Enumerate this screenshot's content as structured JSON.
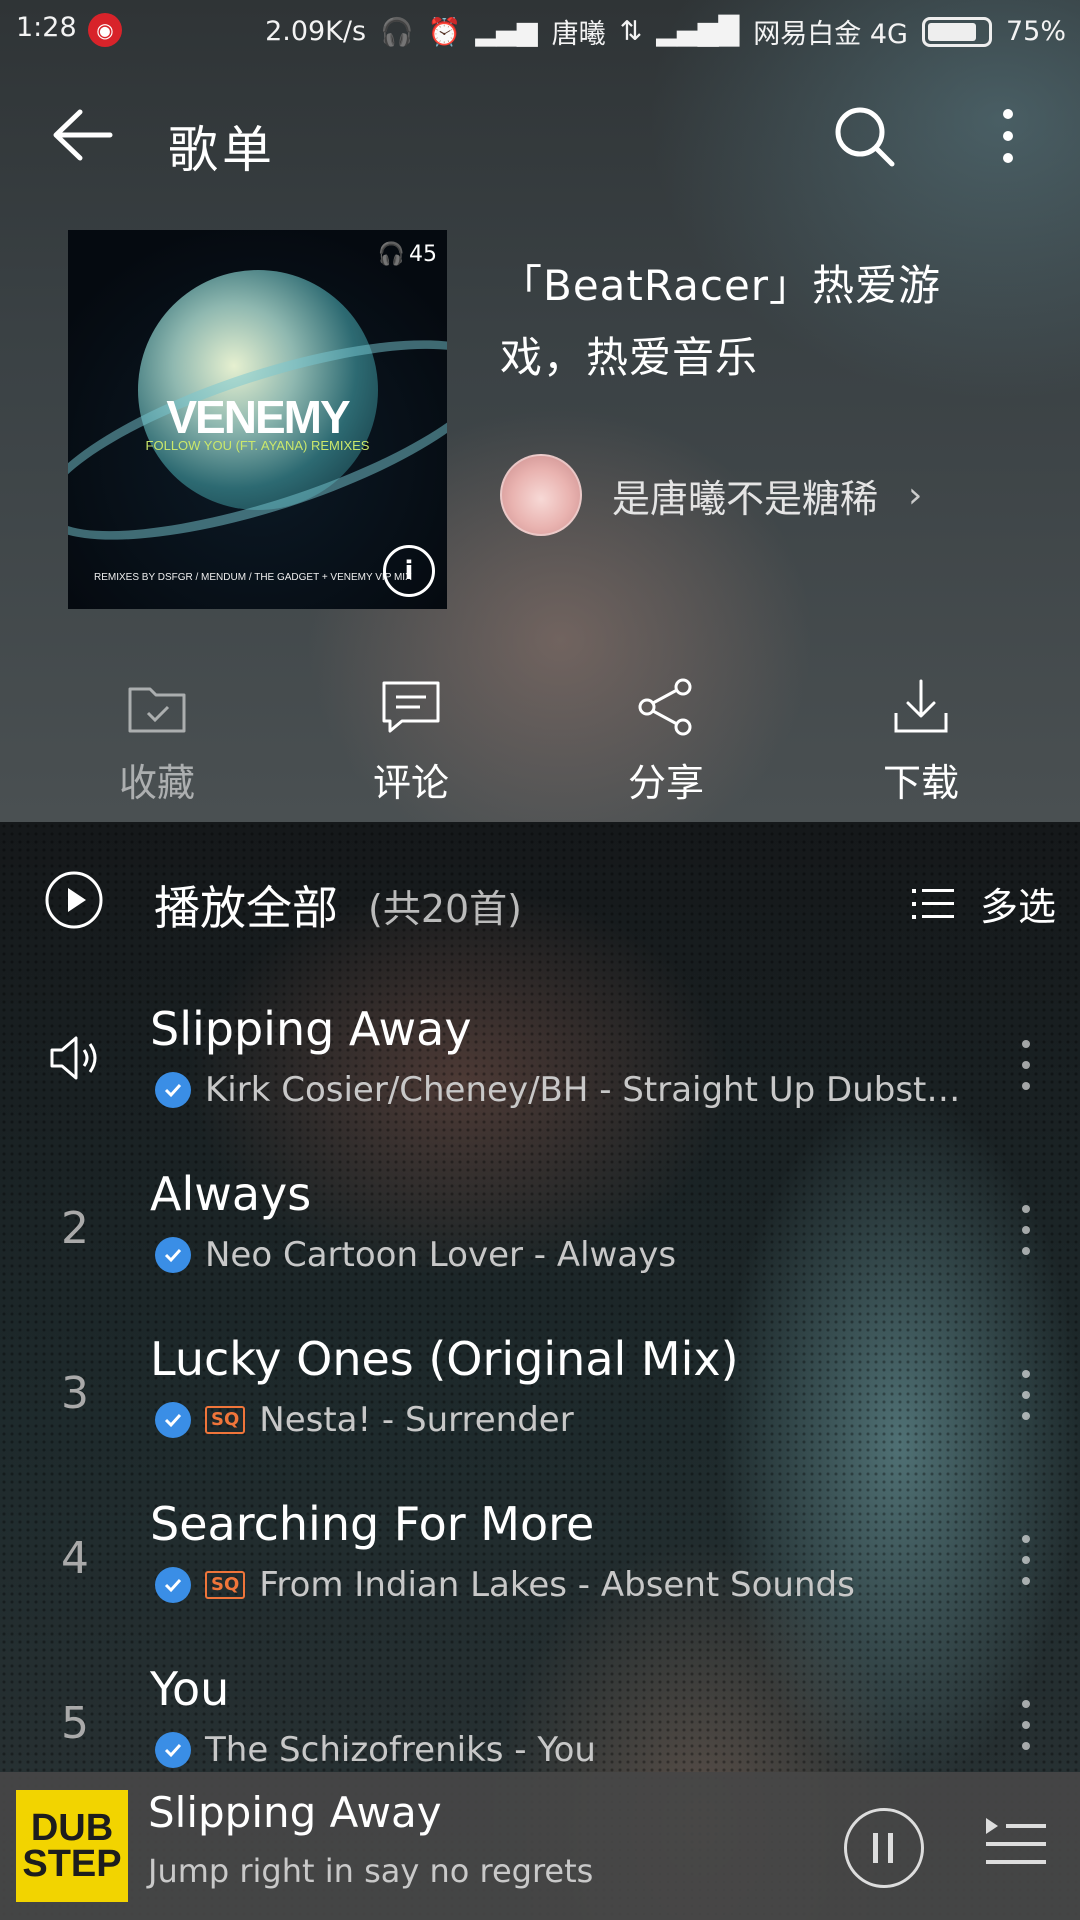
{
  "statusbar": {
    "time": "1:28",
    "speed": "2.09K/s",
    "carrier1": "唐曦",
    "carrier2": "网易白金 4G",
    "battery": "75%"
  },
  "header": {
    "title": "歌单"
  },
  "playlist": {
    "title": "「BeatRacer」热爱游戏，热爱音乐",
    "creator": "是唐曦不是糖稀",
    "cover": {
      "brand": "VENEMY",
      "subtitle": "FOLLOW YOU (FT. AYANA) REMIXES",
      "credits": "REMIXES BY DSFGR / MENDUM / THE GADGET + VENEMY VIP MIX",
      "plays": "45"
    }
  },
  "actions": [
    {
      "label": "收藏"
    },
    {
      "label": "评论"
    },
    {
      "label": "分享"
    },
    {
      "label": "下载"
    }
  ],
  "playall": {
    "label": "播放全部",
    "count": "(共20首)",
    "multi": "多选"
  },
  "songs": [
    {
      "num": "",
      "title": "Slipping Away",
      "sq": "",
      "sub": "Kirk Cosier/Cheney/BH - Straight Up Dubst…"
    },
    {
      "num": "2",
      "title": "Always",
      "sq": "",
      "sub": "Neo Cartoon Lover - Always"
    },
    {
      "num": "3",
      "title": "Lucky Ones (Original Mix)",
      "sq": "SQ",
      "sub": "Nesta! - Surrender"
    },
    {
      "num": "4",
      "title": "Searching For More",
      "sq": "SQ",
      "sub": "From Indian Lakes - Absent Sounds"
    },
    {
      "num": "5",
      "title": "You",
      "sq": "",
      "sub": "The Schizofreniks - You"
    }
  ],
  "now_playing": {
    "title": "Slipping Away",
    "subtitle": "Jump right in say no regrets",
    "thumb_text": "DUB STEP"
  }
}
